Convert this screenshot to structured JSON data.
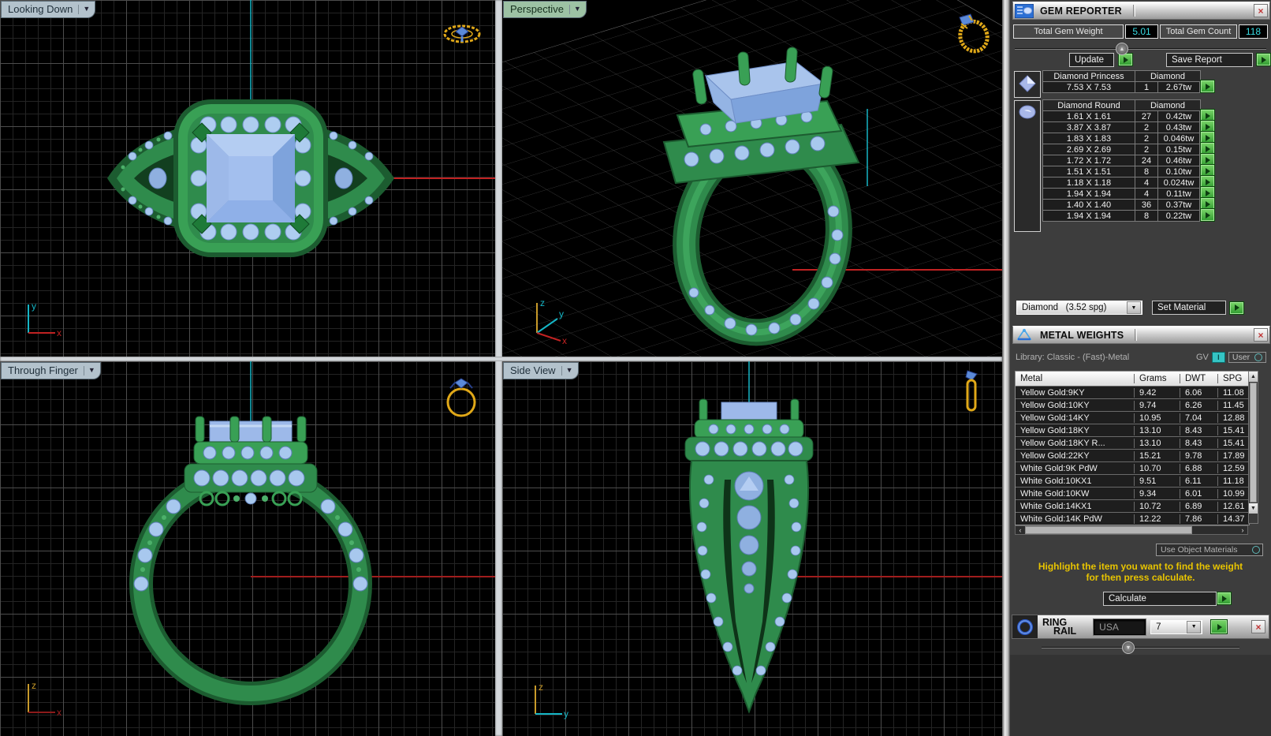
{
  "viewports": {
    "looking_down": {
      "label": "Looking Down",
      "axis_v": "y",
      "axis_h": "x"
    },
    "perspective": {
      "label": "Perspective",
      "axis_v": "z",
      "axis_d": "y",
      "axis_h": "x"
    },
    "through_finger": {
      "label": "Through Finger",
      "axis_v": "z",
      "axis_h": "x"
    },
    "side_view": {
      "label": "Side View",
      "axis_v": "z",
      "axis_h": "y"
    }
  },
  "gem_reporter": {
    "title": "GEM REPORTER",
    "total_weight_label": "Total Gem Weight",
    "total_weight": "5.01",
    "total_count_label": "Total Gem Count",
    "total_count": "118",
    "update_label": "Update",
    "save_report_label": "Save Report",
    "groups": [
      {
        "icon": "princess-cut-icon",
        "name": "Diamond Princess",
        "material": "Diamond",
        "rows": [
          {
            "size": "7.53 X 7.53",
            "count": "1",
            "weight": "2.67tw"
          }
        ]
      },
      {
        "icon": "round-cut-icon",
        "name": "Diamond Round",
        "material": "Diamond",
        "rows": [
          {
            "size": "1.61 X 1.61",
            "count": "27",
            "weight": "0.42tw"
          },
          {
            "size": "3.87 X 3.87",
            "count": "2",
            "weight": "0.43tw"
          },
          {
            "size": "1.83 X 1.83",
            "count": "2",
            "weight": "0.046tw"
          },
          {
            "size": "2.69 X 2.69",
            "count": "2",
            "weight": "0.15tw"
          },
          {
            "size": "1.72 X 1.72",
            "count": "24",
            "weight": "0.46tw"
          },
          {
            "size": "1.51 X 1.51",
            "count": "8",
            "weight": "0.10tw"
          },
          {
            "size": "1.18 X 1.18",
            "count": "4",
            "weight": "0.024tw"
          },
          {
            "size": "1.94 X 1.94",
            "count": "4",
            "weight": "0.11tw"
          },
          {
            "size": "1.40 X 1.40",
            "count": "36",
            "weight": "0.37tw"
          },
          {
            "size": "1.94 X 1.94",
            "count": "8",
            "weight": "0.22tw"
          }
        ]
      }
    ],
    "material_name": "Diamond",
    "material_spg": "(3.52 spg)",
    "set_material_label": "Set Material"
  },
  "metal_weights": {
    "title": "METAL WEIGHTS",
    "library_label": "Library: Classic - (Fast)-Metal",
    "gv_label": "GV",
    "user_label": "User",
    "columns": [
      "Metal",
      "Grams",
      "DWT",
      "SPG"
    ],
    "rows": [
      [
        "Yellow Gold:9KY",
        "9.42",
        "6.06",
        "11.08"
      ],
      [
        "Yellow Gold:10KY",
        "9.74",
        "6.26",
        "11.45"
      ],
      [
        "Yellow Gold:14KY",
        "10.95",
        "7.04",
        "12.88"
      ],
      [
        "Yellow Gold:18KY",
        "13.10",
        "8.43",
        "15.41"
      ],
      [
        "Yellow Gold:18KY R...",
        "13.10",
        "8.43",
        "15.41"
      ],
      [
        "Yellow Gold:22KY",
        "15.21",
        "9.78",
        "17.89"
      ],
      [
        "White Gold:9K PdW",
        "10.70",
        "6.88",
        "12.59"
      ],
      [
        "White Gold:10KX1",
        "9.51",
        "6.11",
        "11.18"
      ],
      [
        "White Gold:10KW",
        "9.34",
        "6.01",
        "10.99"
      ],
      [
        "White Gold:14KX1",
        "10.72",
        "6.89",
        "12.61"
      ],
      [
        "White Gold:14K PdW",
        "12.22",
        "7.86",
        "14.37"
      ]
    ],
    "use_object_materials_label": "Use Object Materials",
    "instruction_line1": "Highlight the item you want to find the weight",
    "instruction_line2": "for then press calculate.",
    "calculate_label": "Calculate"
  },
  "ring_rail": {
    "title_line1": "RING",
    "title_line2": "RAIL",
    "region": "USA",
    "size": "7"
  },
  "colors": {
    "accent_green": "#2f9b2f",
    "metal_green": "#2f8b4c",
    "gem_blue": "#9db9e9",
    "value_cyan": "#38dde4",
    "warning_yellow": "#e8c400"
  }
}
